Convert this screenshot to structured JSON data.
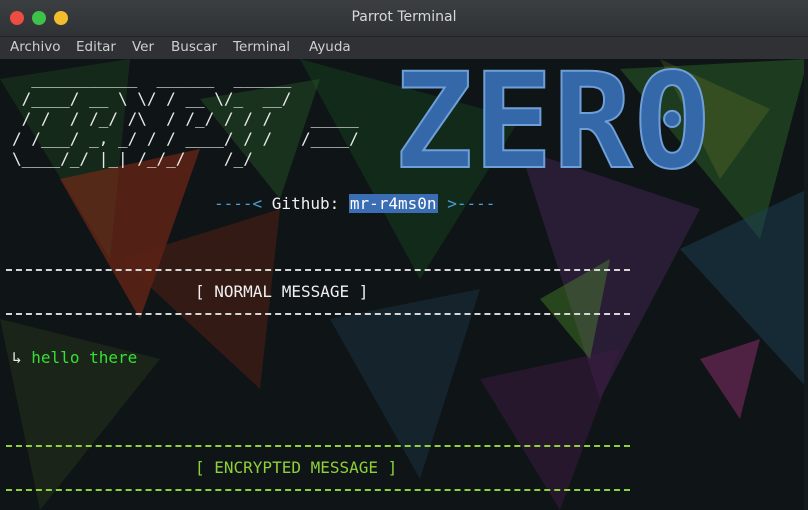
{
  "window": {
    "title": "Parrot Terminal"
  },
  "menubar": {
    "items": [
      "Archivo",
      "Editar",
      "Ver",
      "Buscar",
      "Terminal",
      "Ayuda"
    ]
  },
  "terminal": {
    "banner_ascii": "  ___________  ______  ______\n /____/ __ \\ \\/ / __ \\/_  __/\n / /  / /_/ /\\  / /_/ / / /    _____\n/ /___/ _, _/ / / ____/ / /   /____/\n\\____/_/ |_| /_/_/    /_/",
    "logo_text": "ZER0",
    "github": {
      "prefix": "----< ",
      "label": "Github: ",
      "username": "mr-r4ms0n",
      "suffix": " >----"
    },
    "normal_section": {
      "header": "[ NORMAL MESSAGE ]",
      "arrow": "↳",
      "message": "hello there"
    },
    "encrypted_section": {
      "header": "[ ENCRYPTED MESSAGE ]"
    },
    "colors": {
      "message_green": "#35e035",
      "rule_green": "#8fd13a",
      "logo_blue": "#3468a8",
      "username_highlight": "#3a6db3"
    }
  }
}
